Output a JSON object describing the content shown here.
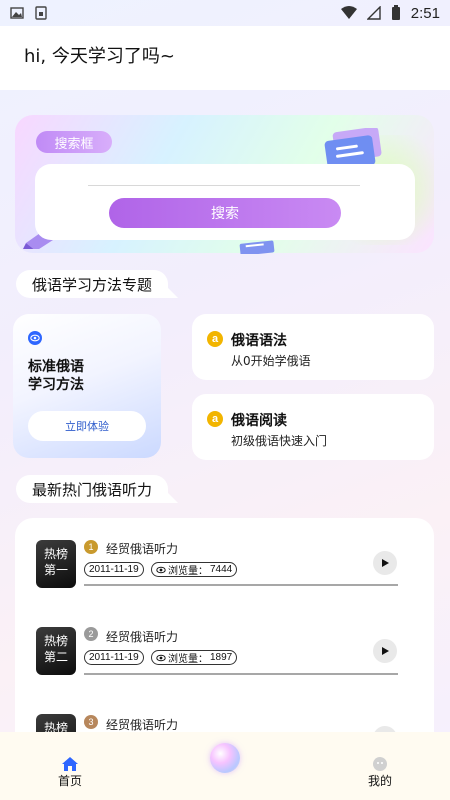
{
  "status_bar": {
    "time": "2:51"
  },
  "header": {
    "greeting": "hi, 今天学习了吗~"
  },
  "search": {
    "tag": "搜索框",
    "placeholder": "",
    "button_label": "搜索"
  },
  "methods": {
    "section_title": "俄语学习方法专题",
    "big_card": {
      "title": "标准俄语\n学习方法",
      "button_label": "立即体验"
    },
    "cards": [
      {
        "badge": "a",
        "title": "俄语语法",
        "subtitle": "从0开始学俄语"
      },
      {
        "badge": "a",
        "title": "俄语阅读",
        "subtitle": "初级俄语快速入门"
      }
    ]
  },
  "listening": {
    "section_title": "最新热门俄语听力",
    "views_label": "浏览量：",
    "items": [
      {
        "thumb": "热榜\n第一",
        "rank": "1",
        "rank_color": "#c99a2e",
        "title": "经贸俄语听力",
        "date": "2011-11-19",
        "views": "7444"
      },
      {
        "thumb": "热榜\n第二",
        "rank": "2",
        "rank_color": "#9a9a9a",
        "title": "经贸俄语听力",
        "date": "2011-11-19",
        "views": "1897"
      },
      {
        "thumb": "热榜",
        "rank": "3",
        "rank_color": "#b7875c",
        "title": "经贸俄语听力",
        "date": "",
        "views": ""
      }
    ]
  },
  "bottom_nav": {
    "home_label": "首页",
    "mine_label": "我的",
    "active_color": "#2e66ff"
  }
}
